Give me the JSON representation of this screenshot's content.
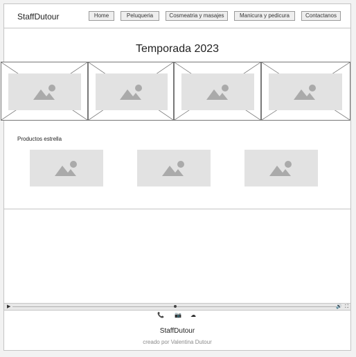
{
  "header": {
    "brand": "StaffDutour",
    "nav": [
      "Home",
      "Peluqueria",
      "Cosmeatria y masajes",
      "Manicura y pedicura",
      "Contactanos"
    ]
  },
  "hero": {
    "title": "Temporada 2023"
  },
  "carousel": {
    "slides": [
      "image-placeholder-icon",
      "image-placeholder-icon",
      "image-placeholder-icon",
      "image-placeholder-icon"
    ]
  },
  "products": {
    "title": "Productos estrella",
    "items": [
      "image-placeholder-icon",
      "image-placeholder-icon",
      "image-placeholder-icon"
    ]
  },
  "video": {
    "progress": 0.5
  },
  "social": [
    "phone-icon",
    "camera-icon",
    "cloud-icon"
  ],
  "footer": {
    "brand": "StaffDutour",
    "credit": "creado por Valentina Dutour"
  },
  "colors": {
    "placeholder": "#e2e2e2",
    "border": "#c4c4c4",
    "muted_text": "#8a8a8a"
  }
}
